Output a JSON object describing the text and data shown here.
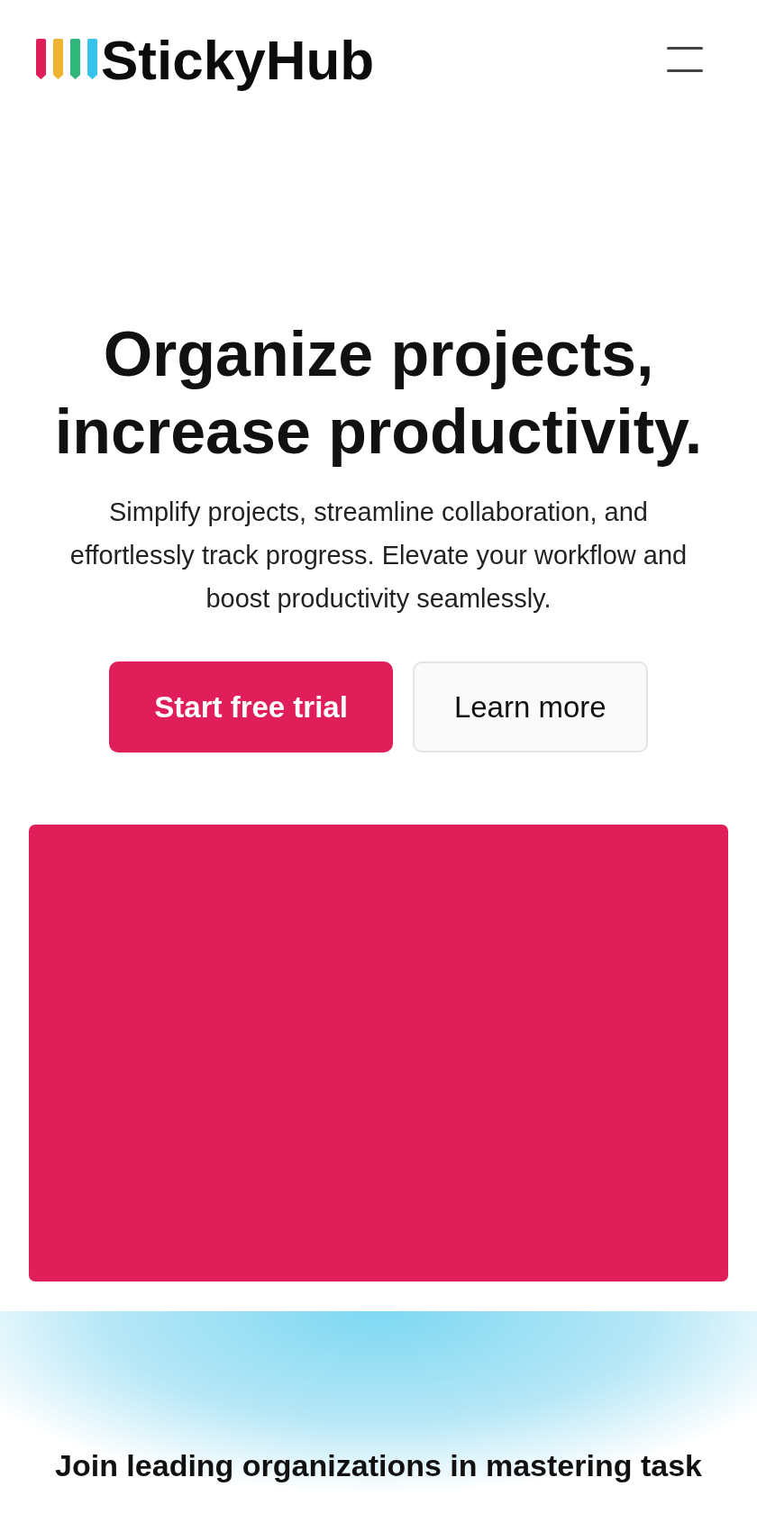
{
  "header": {
    "logo": {
      "text": "StickyHub",
      "stripes": [
        {
          "color": "#e01f5a"
        },
        {
          "color": "#efb32f"
        },
        {
          "color": "#2fb67a"
        },
        {
          "color": "#38c3ec"
        }
      ]
    }
  },
  "hero": {
    "title": "Organize projects, increase productivity.",
    "subtitle": "Simplify projects, streamline collaboration, and effortlessly track progress. Elevate your workflow and boost productivity seamlessly.",
    "buttons": [
      {
        "label": "Start free trial",
        "kind": "primary"
      },
      {
        "label": "Learn more",
        "kind": "secondary"
      }
    ],
    "media": {
      "kind": "panel"
    }
  },
  "partners": {
    "heading": "Join leading organizations in mastering task"
  }
}
